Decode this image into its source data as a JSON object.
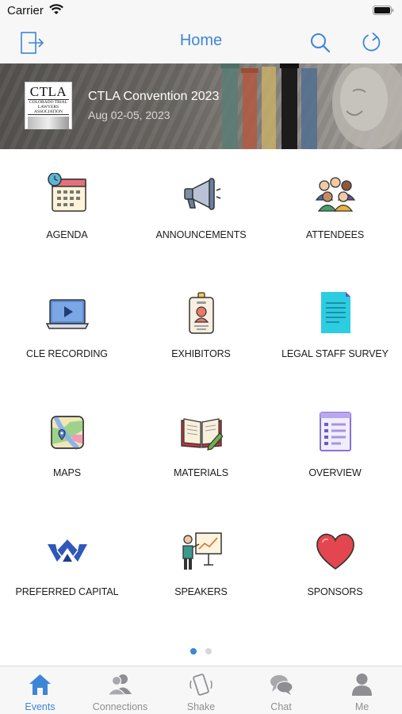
{
  "status_bar": {
    "carrier": "Carrier"
  },
  "nav": {
    "title": "Home",
    "left_icon": "logout-icon",
    "right_icons": [
      "search-icon",
      "refresh-icon"
    ]
  },
  "banner": {
    "logo_main": "CTLA",
    "logo_sub": "COLORADO TRIAL LAWYERS ASSOCIATION",
    "title": "CTLA Convention 2023",
    "date": "Aug 02-05, 2023"
  },
  "tiles": [
    {
      "label": "AGENDA",
      "icon": "calendar-clock-icon"
    },
    {
      "label": "ANNOUNCEMENTS",
      "icon": "megaphone-icon"
    },
    {
      "label": "ATTENDEES",
      "icon": "people-group-icon"
    },
    {
      "label": "CLE RECORDING",
      "icon": "laptop-video-icon"
    },
    {
      "label": "EXHIBITORS",
      "icon": "id-badge-icon"
    },
    {
      "label": "LEGAL STAFF SURVEY",
      "icon": "document-icon"
    },
    {
      "label": "MAPS",
      "icon": "map-icon"
    },
    {
      "label": "MATERIALS",
      "icon": "open-book-pencil-icon"
    },
    {
      "label": "OVERVIEW",
      "icon": "list-window-icon"
    },
    {
      "label": "PREFERRED CAPITAL",
      "icon": "preferred-capital-logo-icon"
    },
    {
      "label": "SPEAKERS",
      "icon": "presenter-board-icon"
    },
    {
      "label": "SPONSORS",
      "icon": "heart-icon"
    }
  ],
  "pager": {
    "pages": 2,
    "current": 1
  },
  "tabs": [
    {
      "label": "Events",
      "icon": "house-icon",
      "active": true
    },
    {
      "label": "Connections",
      "icon": "connections-icon",
      "active": false
    },
    {
      "label": "Shake",
      "icon": "shake-phone-icon",
      "active": false
    },
    {
      "label": "Chat",
      "icon": "chat-bubbles-icon",
      "active": false
    },
    {
      "label": "Me",
      "icon": "person-icon",
      "active": false
    }
  ],
  "colors": {
    "accent": "#3d86d6",
    "tab_inactive": "#8e8e93",
    "bar_bg": "#f7f7f7"
  }
}
